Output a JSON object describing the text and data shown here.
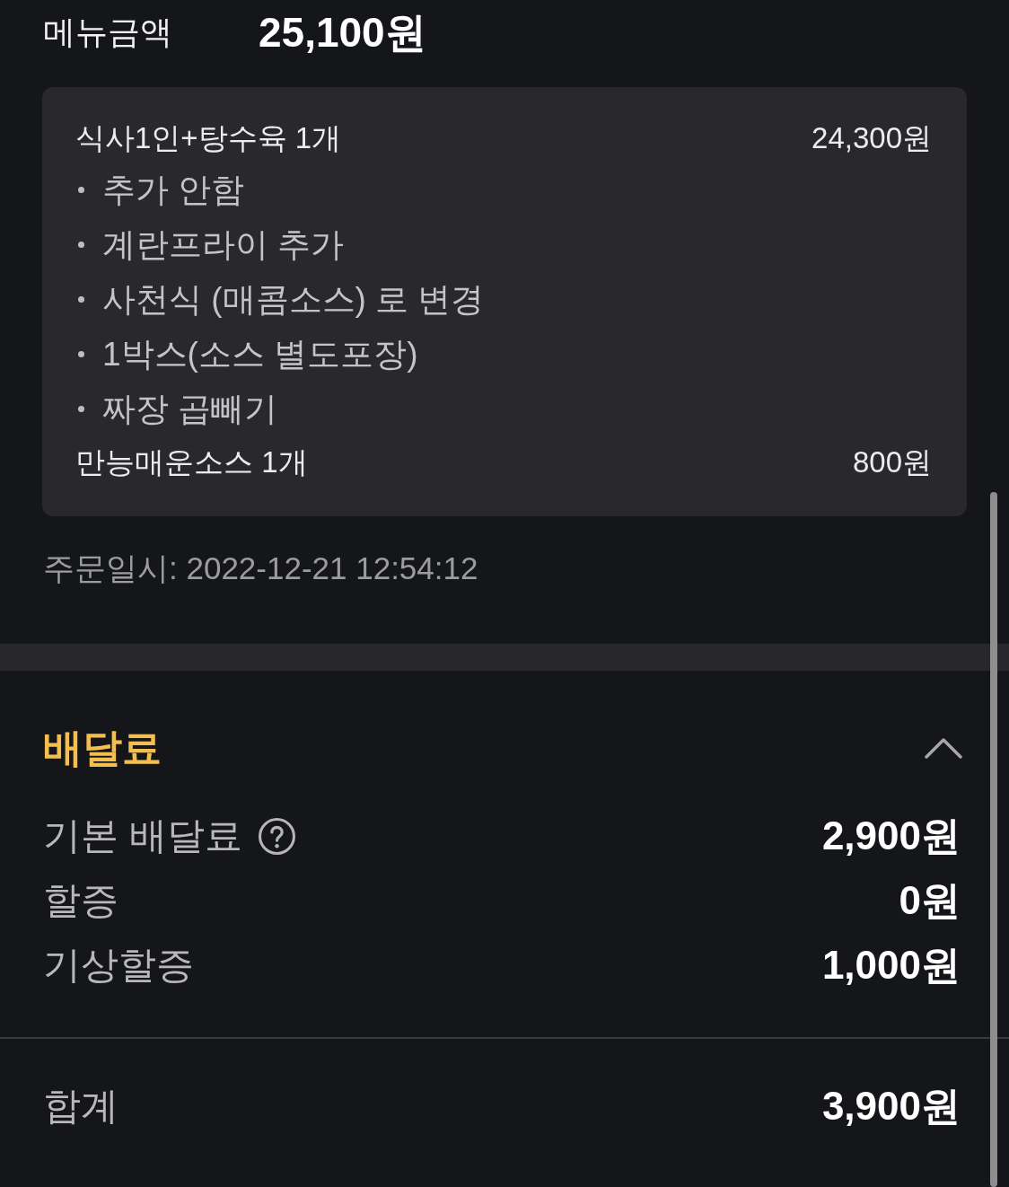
{
  "menu_total": {
    "label": "메뉴금액",
    "value": "25,100원"
  },
  "order_items": [
    {
      "kind": "menu",
      "name": "식사1인+탕수육 1개",
      "price": "24,300원"
    },
    {
      "kind": "option",
      "name": "추가 안함"
    },
    {
      "kind": "option",
      "name": "계란프라이 추가"
    },
    {
      "kind": "option",
      "name": "사천식 (매콤소스) 로 변경"
    },
    {
      "kind": "option",
      "name": "1박스(소스 별도포장)"
    },
    {
      "kind": "option",
      "name": "짜장 곱빼기"
    },
    {
      "kind": "menu",
      "name": "만능매운소스 1개",
      "price": "800원"
    }
  ],
  "order_date": "주문일시: 2022-12-21 12:54:12",
  "delivery_fee": {
    "title": "배달료",
    "expanded": true,
    "rows": [
      {
        "label": "기본 배달료",
        "help": true,
        "value": "2,900원"
      },
      {
        "label": "할증",
        "help": false,
        "value": "0원"
      },
      {
        "label": "기상할증",
        "help": false,
        "value": "1,000원"
      }
    ]
  },
  "total": {
    "label": "합계",
    "value": "3,900원"
  }
}
